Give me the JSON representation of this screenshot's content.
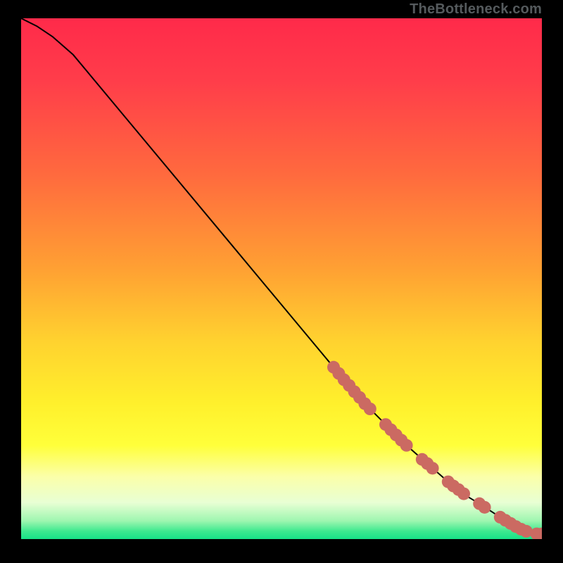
{
  "watermark": "TheBottleneck.com",
  "chart_data": {
    "type": "line",
    "title": "",
    "xlabel": "",
    "ylabel": "",
    "xlim": [
      0,
      100
    ],
    "ylim": [
      0,
      100
    ],
    "grid": false,
    "legend": false,
    "series": [
      {
        "name": "curve",
        "style": "line",
        "x": [
          0,
          3,
          6,
          10,
          20,
          30,
          40,
          50,
          60,
          66,
          70,
          74,
          78,
          82,
          86,
          88,
          90,
          92,
          94,
          95,
          96,
          97,
          98,
          99,
          100
        ],
        "y": [
          100,
          98.5,
          96.5,
          93,
          81,
          69,
          57,
          45,
          33,
          26,
          22,
          18,
          14.5,
          11,
          8,
          6.8,
          5.5,
          4.2,
          3.0,
          2.4,
          1.9,
          1.5,
          1.2,
          1.05,
          1.0
        ]
      },
      {
        "name": "points",
        "style": "scatter",
        "x": [
          60,
          61,
          62,
          63,
          64,
          65,
          66,
          67,
          70,
          71,
          72,
          73,
          74,
          77,
          78,
          79,
          82,
          83,
          84,
          85,
          88,
          89,
          92,
          93,
          94,
          95,
          96,
          97,
          99,
          100
        ],
        "y": [
          33.0,
          31.8,
          30.6,
          29.5,
          28.3,
          27.2,
          26.0,
          25.0,
          22.0,
          21.0,
          20.0,
          19.0,
          18.0,
          15.3,
          14.5,
          13.6,
          11.0,
          10.2,
          9.5,
          8.7,
          6.8,
          6.1,
          4.2,
          3.6,
          3.0,
          2.4,
          1.9,
          1.5,
          1.0,
          1.0
        ]
      }
    ],
    "gradient_stops": [
      {
        "offset": 0.0,
        "color": "#ff2a4a"
      },
      {
        "offset": 0.12,
        "color": "#ff3d4a"
      },
      {
        "offset": 0.3,
        "color": "#ff6a3e"
      },
      {
        "offset": 0.48,
        "color": "#ffa033"
      },
      {
        "offset": 0.62,
        "color": "#ffd22f"
      },
      {
        "offset": 0.74,
        "color": "#fff02c"
      },
      {
        "offset": 0.82,
        "color": "#ffff3a"
      },
      {
        "offset": 0.88,
        "color": "#fbffa9"
      },
      {
        "offset": 0.93,
        "color": "#e8ffd4"
      },
      {
        "offset": 0.965,
        "color": "#9ef6b0"
      },
      {
        "offset": 0.985,
        "color": "#3de98f"
      },
      {
        "offset": 1.0,
        "color": "#17e287"
      }
    ],
    "curve_color": "#000000",
    "point_color": "#cb6a62",
    "point_radius": 9
  }
}
